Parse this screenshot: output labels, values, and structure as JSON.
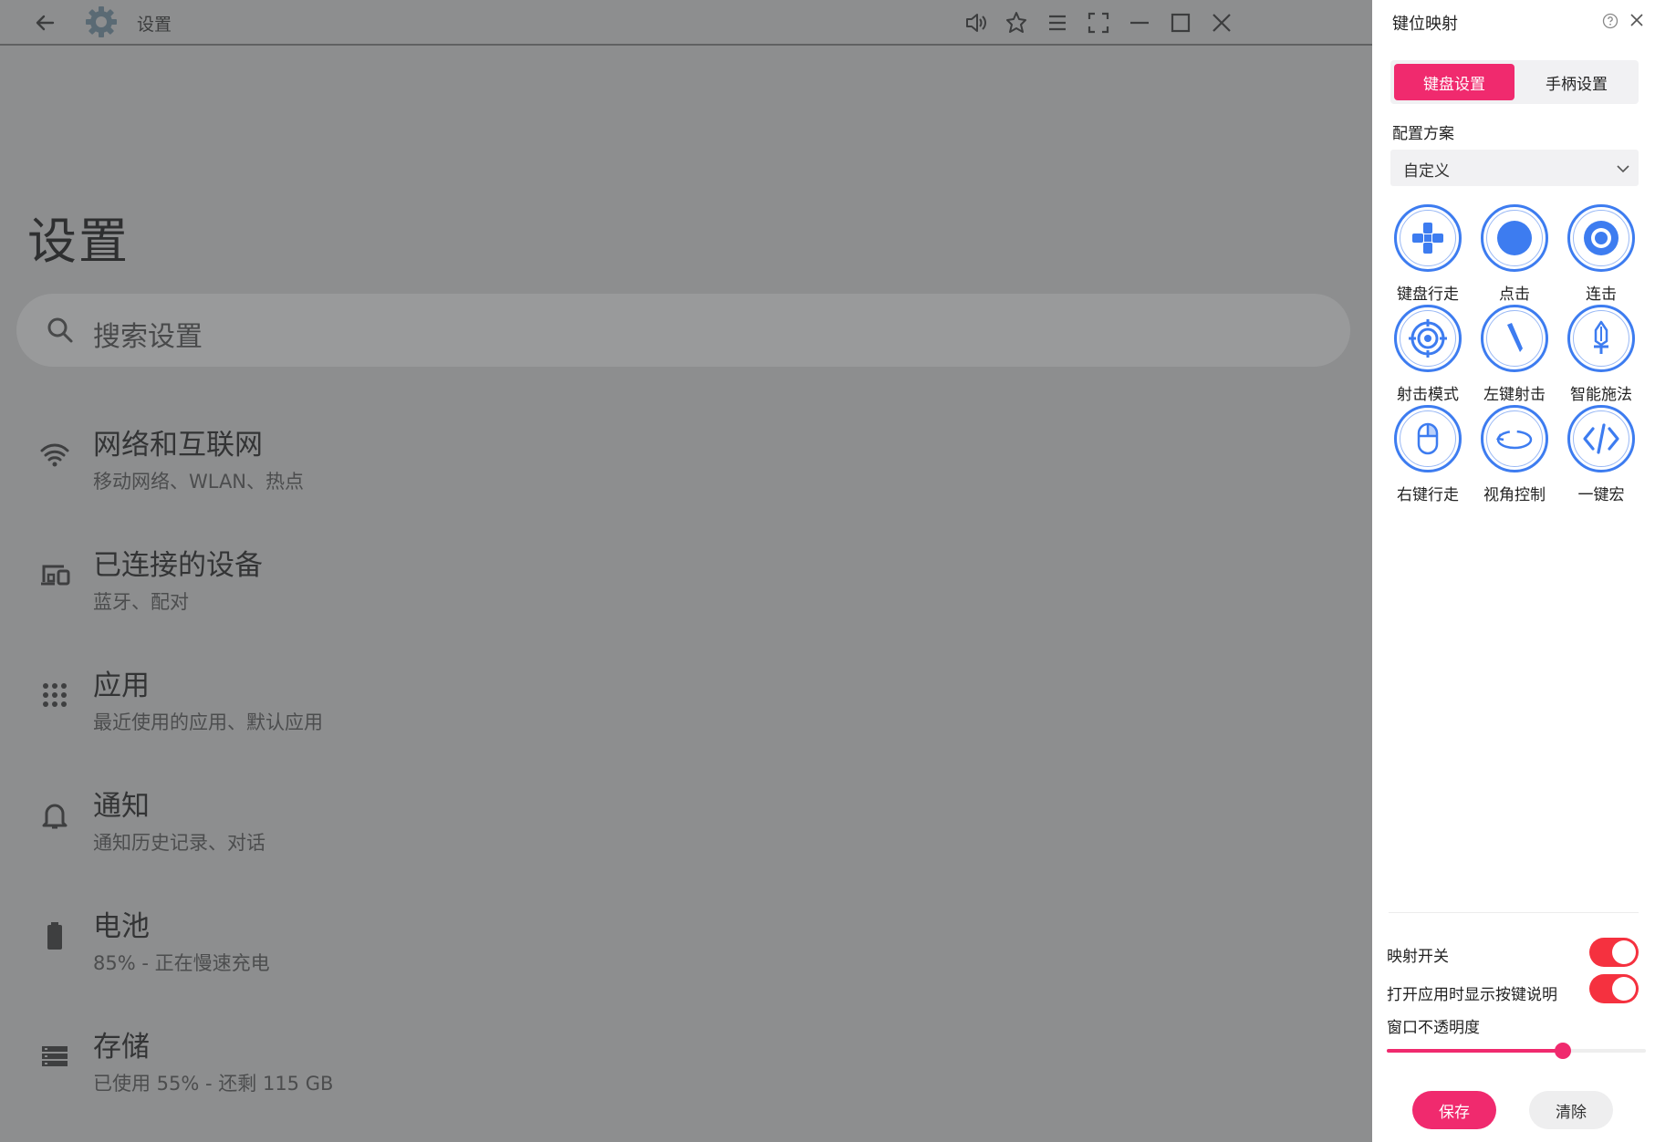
{
  "titlebar": {
    "title": "设置",
    "buttons": [
      "volume-icon",
      "pin-icon",
      "menu-icon",
      "fullscreen-icon",
      "minimize-icon",
      "maximize-icon",
      "close-icon"
    ]
  },
  "page": {
    "title": "设置",
    "search_placeholder": "搜索设置",
    "items": [
      {
        "icon": "wifi-icon",
        "title": "网络和互联网",
        "subtitle": "移动网络、WLAN、热点"
      },
      {
        "icon": "devices-icon",
        "title": "已连接的设备",
        "subtitle": "蓝牙、配对"
      },
      {
        "icon": "apps-icon",
        "title": "应用",
        "subtitle": "最近使用的应用、默认应用"
      },
      {
        "icon": "bell-icon",
        "title": "通知",
        "subtitle": "通知历史记录、对话"
      },
      {
        "icon": "battery-icon",
        "title": "电池",
        "subtitle": "85% - 正在慢速充电"
      },
      {
        "icon": "storage-icon",
        "title": "存储",
        "subtitle": "已使用 55% - 还剩 115 GB"
      }
    ]
  },
  "panel": {
    "title": "键位映射",
    "tabs": {
      "keyboard": "键盘设置",
      "gamepad": "手柄设置"
    },
    "scheme_label": "配置方案",
    "scheme_value": "自定义",
    "keys": [
      {
        "label": "键盘行走",
        "icon": "dpad-icon"
      },
      {
        "label": "点击",
        "icon": "tap-icon"
      },
      {
        "label": "连击",
        "icon": "combo-icon"
      },
      {
        "label": "射击模式",
        "icon": "crosshair-icon"
      },
      {
        "label": "左键射击",
        "icon": "left-click-shoot-icon"
      },
      {
        "label": "智能施法",
        "icon": "sword-icon"
      },
      {
        "label": "右键行走",
        "icon": "mouse-icon"
      },
      {
        "label": "视角控制",
        "icon": "rotate-view-icon"
      },
      {
        "label": "一键宏",
        "icon": "code-icon"
      }
    ],
    "mapping_switch_label": "映射开关",
    "mapping_switch_on": true,
    "show_hint_label": "打开应用时显示按键说明",
    "show_hint_on": true,
    "opacity_label": "窗口不透明度",
    "opacity_fraction": 0.68,
    "save_label": "保存",
    "clear_label": "清除",
    "accent": "#f02a6e",
    "toggle_color": "#f5313f",
    "icon_color": "#3d7cf0"
  }
}
